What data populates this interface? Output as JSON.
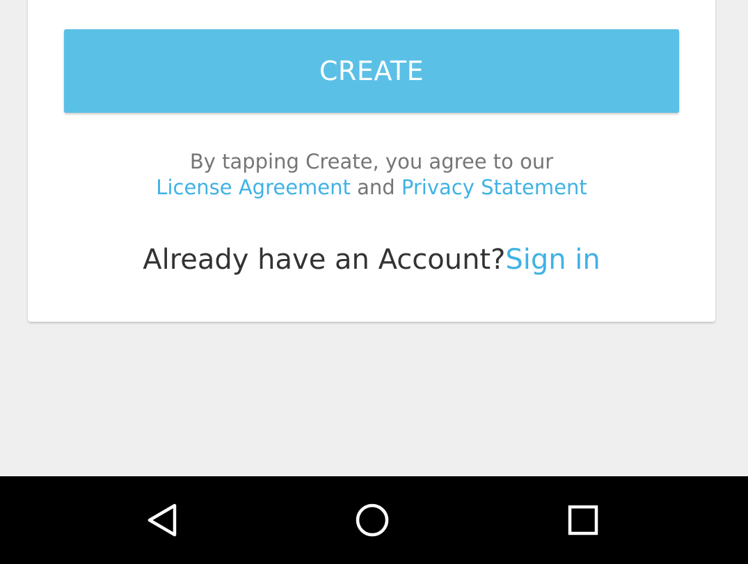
{
  "form": {
    "create_label": "CREATE",
    "terms_prefix": "By tapping Create, you agree to our",
    "license_link": "License Agreement",
    "terms_and": "and",
    "privacy_link": "Privacy Statement",
    "account_prompt": "Already have an Account?",
    "signin_link": "Sign in"
  },
  "colors": {
    "accent": "#5bc0e6",
    "link": "#3fb2e4",
    "background": "#efefef",
    "card": "#ffffff",
    "navbar": "#000000"
  },
  "navbar": {
    "icons": [
      "back-icon",
      "home-icon",
      "recents-icon"
    ]
  }
}
